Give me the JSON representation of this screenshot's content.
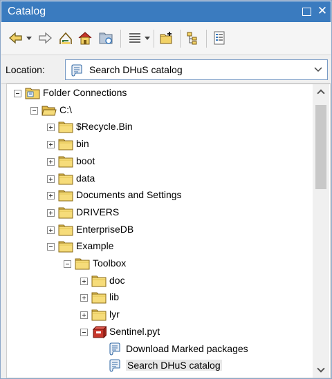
{
  "window": {
    "title": "Catalog"
  },
  "toolbar": {
    "icons": [
      "back-icon",
      "forward-icon",
      "up-one-level-icon",
      "home-icon",
      "connect-folder-icon",
      "views-icon",
      "new-folder-icon",
      "toggle-contents-icon",
      "properties-icon"
    ]
  },
  "location": {
    "label": "Location:",
    "value": "Search DHuS catalog"
  },
  "tree": {
    "items": [
      {
        "label": "Folder Connections",
        "state": "expanded",
        "icon": "folder-connections-icon"
      },
      {
        "label": "C:\\",
        "state": "expanded",
        "icon": "open-folder-icon"
      },
      {
        "label": "$Recycle.Bin",
        "state": "collapsed",
        "icon": "folder-icon"
      },
      {
        "label": "bin",
        "state": "collapsed",
        "icon": "folder-icon"
      },
      {
        "label": "boot",
        "state": "collapsed",
        "icon": "folder-icon"
      },
      {
        "label": "data",
        "state": "collapsed",
        "icon": "folder-icon"
      },
      {
        "label": "Documents and Settings",
        "state": "collapsed",
        "icon": "folder-icon"
      },
      {
        "label": "DRIVERS",
        "state": "collapsed",
        "icon": "folder-icon"
      },
      {
        "label": "EnterpriseDB",
        "state": "collapsed",
        "icon": "folder-icon"
      },
      {
        "label": "Example",
        "state": "expanded",
        "icon": "folder-icon"
      },
      {
        "label": "Toolbox",
        "state": "expanded",
        "icon": "folder-icon"
      },
      {
        "label": "doc",
        "state": "collapsed",
        "icon": "folder-icon"
      },
      {
        "label": "lib",
        "state": "collapsed",
        "icon": "folder-icon"
      },
      {
        "label": "lyr",
        "state": "collapsed",
        "icon": "folder-icon"
      },
      {
        "label": "Sentinel.pyt",
        "state": "expanded",
        "icon": "python-toolbox-icon"
      },
      {
        "label": "Download Marked packages",
        "state": "leaf",
        "icon": "script-tool-icon"
      },
      {
        "label": "Search DHuS catalog",
        "state": "leaf",
        "icon": "script-tool-icon",
        "selected": true
      }
    ]
  },
  "colors": {
    "titlebar": "#3a7bbf",
    "folder": "#f2d266",
    "selection": "#e8e8e8"
  }
}
